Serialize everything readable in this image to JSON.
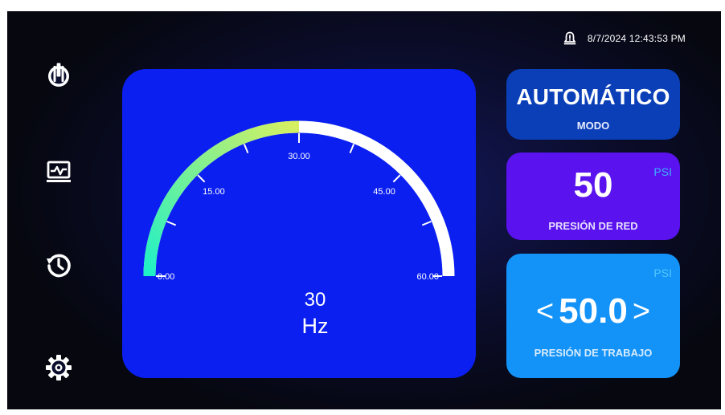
{
  "header": {
    "datetime": "8/7/2024 12:43:53 PM",
    "bell_icon": "bell-alert-icon"
  },
  "sidebar": {
    "items": [
      {
        "name": "power-icon"
      },
      {
        "name": "monitor-chart-icon"
      },
      {
        "name": "history-icon"
      },
      {
        "name": "settings-gear-icon"
      }
    ]
  },
  "gauge": {
    "value": "30",
    "unit": "Hz",
    "reading": 30,
    "min": 0,
    "max": 60,
    "tick_labels": [
      "0.00",
      "15.00",
      "30.00",
      "45.00",
      "60.00"
    ],
    "tick_values": [
      0,
      15,
      30,
      45,
      60
    ],
    "colors": {
      "panel": "#0a1ff0",
      "track": "#ffffff",
      "gradient_start": "#1ef0c8",
      "gradient_end": "#d8f060"
    }
  },
  "mode": {
    "value": "AUTOMÁTICO",
    "label": "MODO"
  },
  "red_pressure": {
    "value": "50",
    "unit": "PSI",
    "label": "PRESIÓN DE RED"
  },
  "work_pressure": {
    "value": "50.0",
    "unit": "PSI",
    "label": "PRESIÓN DE TRABAJO",
    "decrease_symbol": "<",
    "increase_symbol": ">"
  },
  "colors": {
    "mode_card": "#0a3fb8",
    "red_card": "#5a12ee",
    "work_card": "#1392f7",
    "unit_accent": "#3fb0ff"
  }
}
